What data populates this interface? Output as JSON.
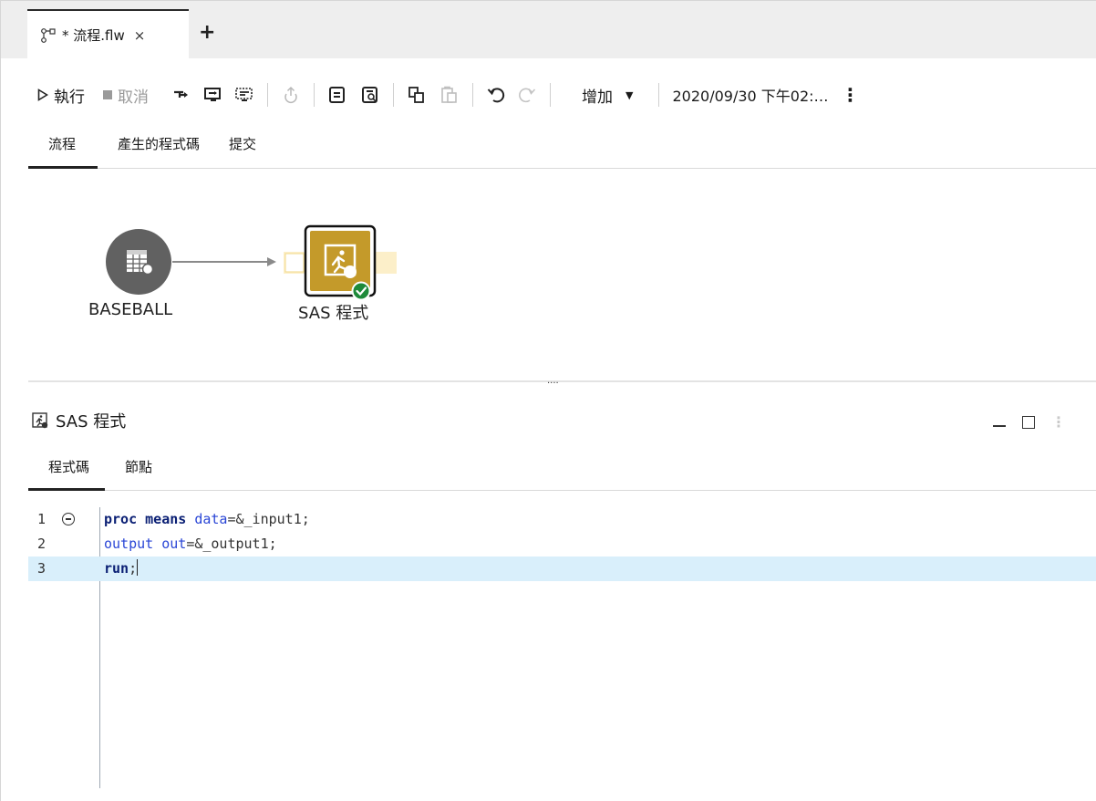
{
  "window": {
    "tab_title": "* 流程.flw",
    "tab_close": "×",
    "tab_add": "+"
  },
  "toolbar": {
    "run_label": "執行",
    "cancel_label": "取消",
    "add_label": "增加",
    "timestamp": "2020/09/30 下午02:…",
    "more": "⋮"
  },
  "subtabs": [
    "流程",
    "產生的程式碼",
    "提交"
  ],
  "flow": {
    "nodes": [
      {
        "label": "BASEBALL",
        "icon": "table-icon",
        "color": "#616161"
      },
      {
        "label": "SAS 程式",
        "icon": "sas-program-icon",
        "color": "#c49a2a",
        "status": "success-check"
      }
    ],
    "divider_handle": "...."
  },
  "panel": {
    "title": "SAS 程式",
    "tabs": [
      "程式碼",
      "節點"
    ],
    "more": "⋮"
  },
  "editor": {
    "lines": [
      {
        "num": "1",
        "kw": "proc means ",
        "kw2": "data",
        "rest": "=&_input1;"
      },
      {
        "num": "2",
        "kw2a": "output out",
        "rest": "=&_output1;"
      },
      {
        "num": "3",
        "kw": "run",
        "rest": ";"
      }
    ]
  },
  "colors": {
    "node_gold": "#c49a2a",
    "node_gray": "#616161",
    "success": "#1e8a3a",
    "current_line": "#d9effb"
  }
}
